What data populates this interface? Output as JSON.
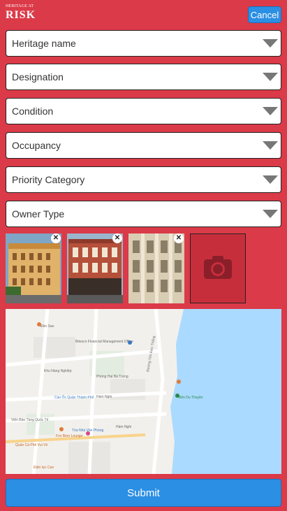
{
  "header": {
    "logo_line1": "HERITAGE AT",
    "logo_line2": "RISK",
    "cancel_label": "Cancel"
  },
  "form": {
    "fields": [
      {
        "label": "Heritage name"
      },
      {
        "label": "Designation"
      },
      {
        "label": "Condition"
      },
      {
        "label": "Occupancy"
      },
      {
        "label": "Priority Category"
      },
      {
        "label": "Owner Type"
      }
    ]
  },
  "photos": {
    "remove_symbol": "✕",
    "items": [
      {
        "name": "photo-1"
      },
      {
        "name": "photo-2"
      },
      {
        "name": "photo-3"
      }
    ]
  },
  "map": {
    "labels": [
      "Đền Sao",
      "Bitexco Financial Management Office",
      "Khu Nàng Nghiệp",
      "Cao Ốc Quận Thành Phố",
      "Hàm Nghi",
      "Hàm Nghi",
      "Đường Tôn Đức Thắng",
      "Bến Du Thuyền",
      "Phòng Hai Bà Trưng",
      "Viện Bảo Tàng Quốc Tế",
      "Quán Cà Phê Vui Vẻ",
      "Tòa Nhà Văn Phòng",
      "Fox Beer Lounge",
      "Điện lực Cao"
    ],
    "colors": {
      "water": "#aadaff",
      "land": "#f2f0ec",
      "road": "#ffffff"
    }
  },
  "submit": {
    "label": "Submit"
  },
  "colors": {
    "background": "#db3a48",
    "accent": "#2b8fe3"
  }
}
